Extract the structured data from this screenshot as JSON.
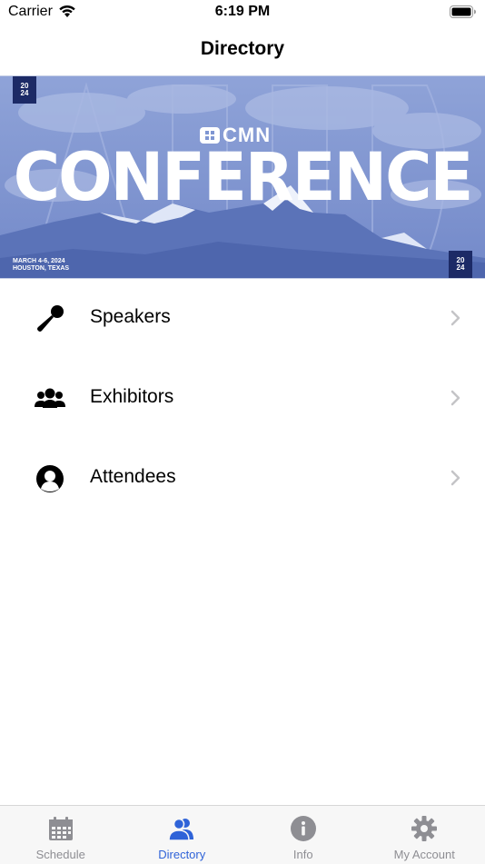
{
  "status_bar": {
    "carrier": "Carrier",
    "time": "6:19 PM"
  },
  "nav": {
    "title": "Directory"
  },
  "banner": {
    "brand": "CMN",
    "title": "CONFERENCE",
    "badge_year_top": "20",
    "badge_year_bottom": "24",
    "date_line": "MARCH 4-6, 2024",
    "location_line": "HOUSTON, TEXAS",
    "colors": {
      "background": "#7f96d2",
      "badge": "#1c2a66"
    }
  },
  "directory": {
    "items": [
      {
        "label": "Speakers",
        "icon": "microphone-icon"
      },
      {
        "label": "Exhibitors",
        "icon": "group-icon"
      },
      {
        "label": "Attendees",
        "icon": "person-circle-icon"
      }
    ]
  },
  "tab_bar": {
    "active_color": "#2f63d8",
    "inactive_color": "#8e8e93",
    "tabs": [
      {
        "label": "Schedule",
        "icon": "calendar-icon",
        "active": false
      },
      {
        "label": "Directory",
        "icon": "people-icon",
        "active": true
      },
      {
        "label": "Info",
        "icon": "info-icon",
        "active": false
      },
      {
        "label": "My Account",
        "icon": "gear-icon",
        "active": false
      }
    ]
  }
}
